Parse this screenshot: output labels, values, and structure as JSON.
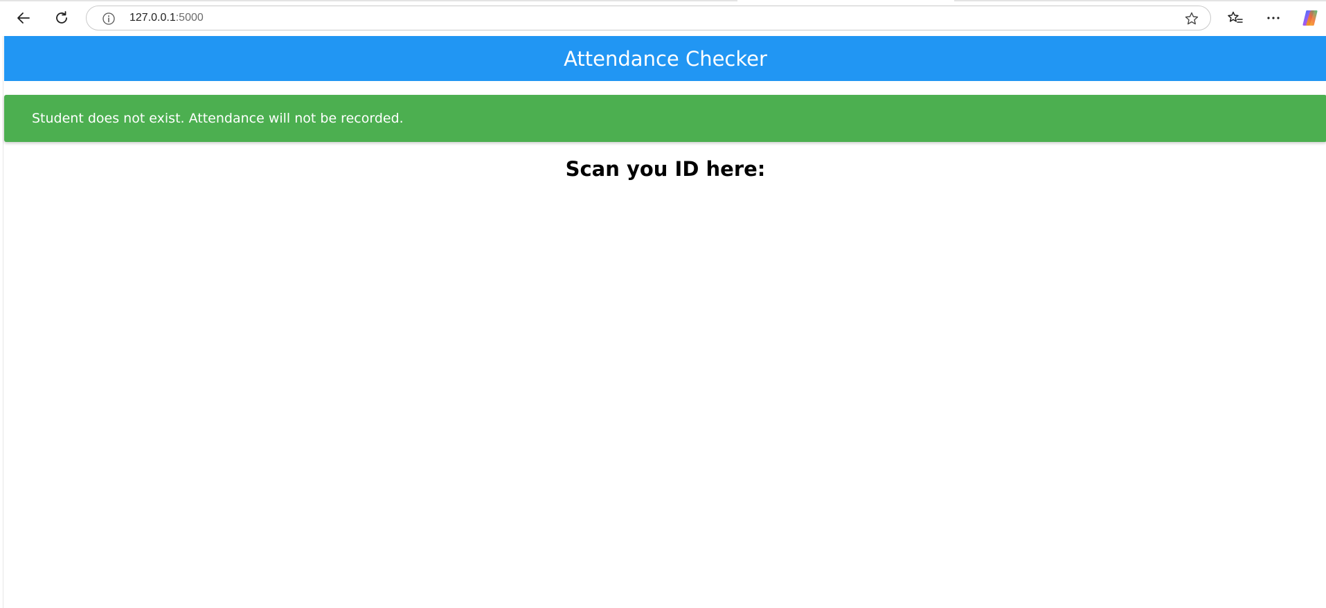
{
  "browser": {
    "url_host": "127.0.0.1",
    "url_port": ":5000",
    "icons": {
      "back": "back-arrow-icon",
      "reload": "reload-icon",
      "info": "site-info-icon",
      "favorite": "star-icon",
      "favorites": "favorites-icon",
      "menu": "more-icon",
      "copilot": "copilot-icon"
    }
  },
  "app": {
    "header_title": "Attendance Checker",
    "header_color": "#2196f3",
    "alert_message": "Student does not exist. Attendance will not be recorded.",
    "alert_color": "#4caf50",
    "scan_prompt": "Scan you ID here:"
  }
}
